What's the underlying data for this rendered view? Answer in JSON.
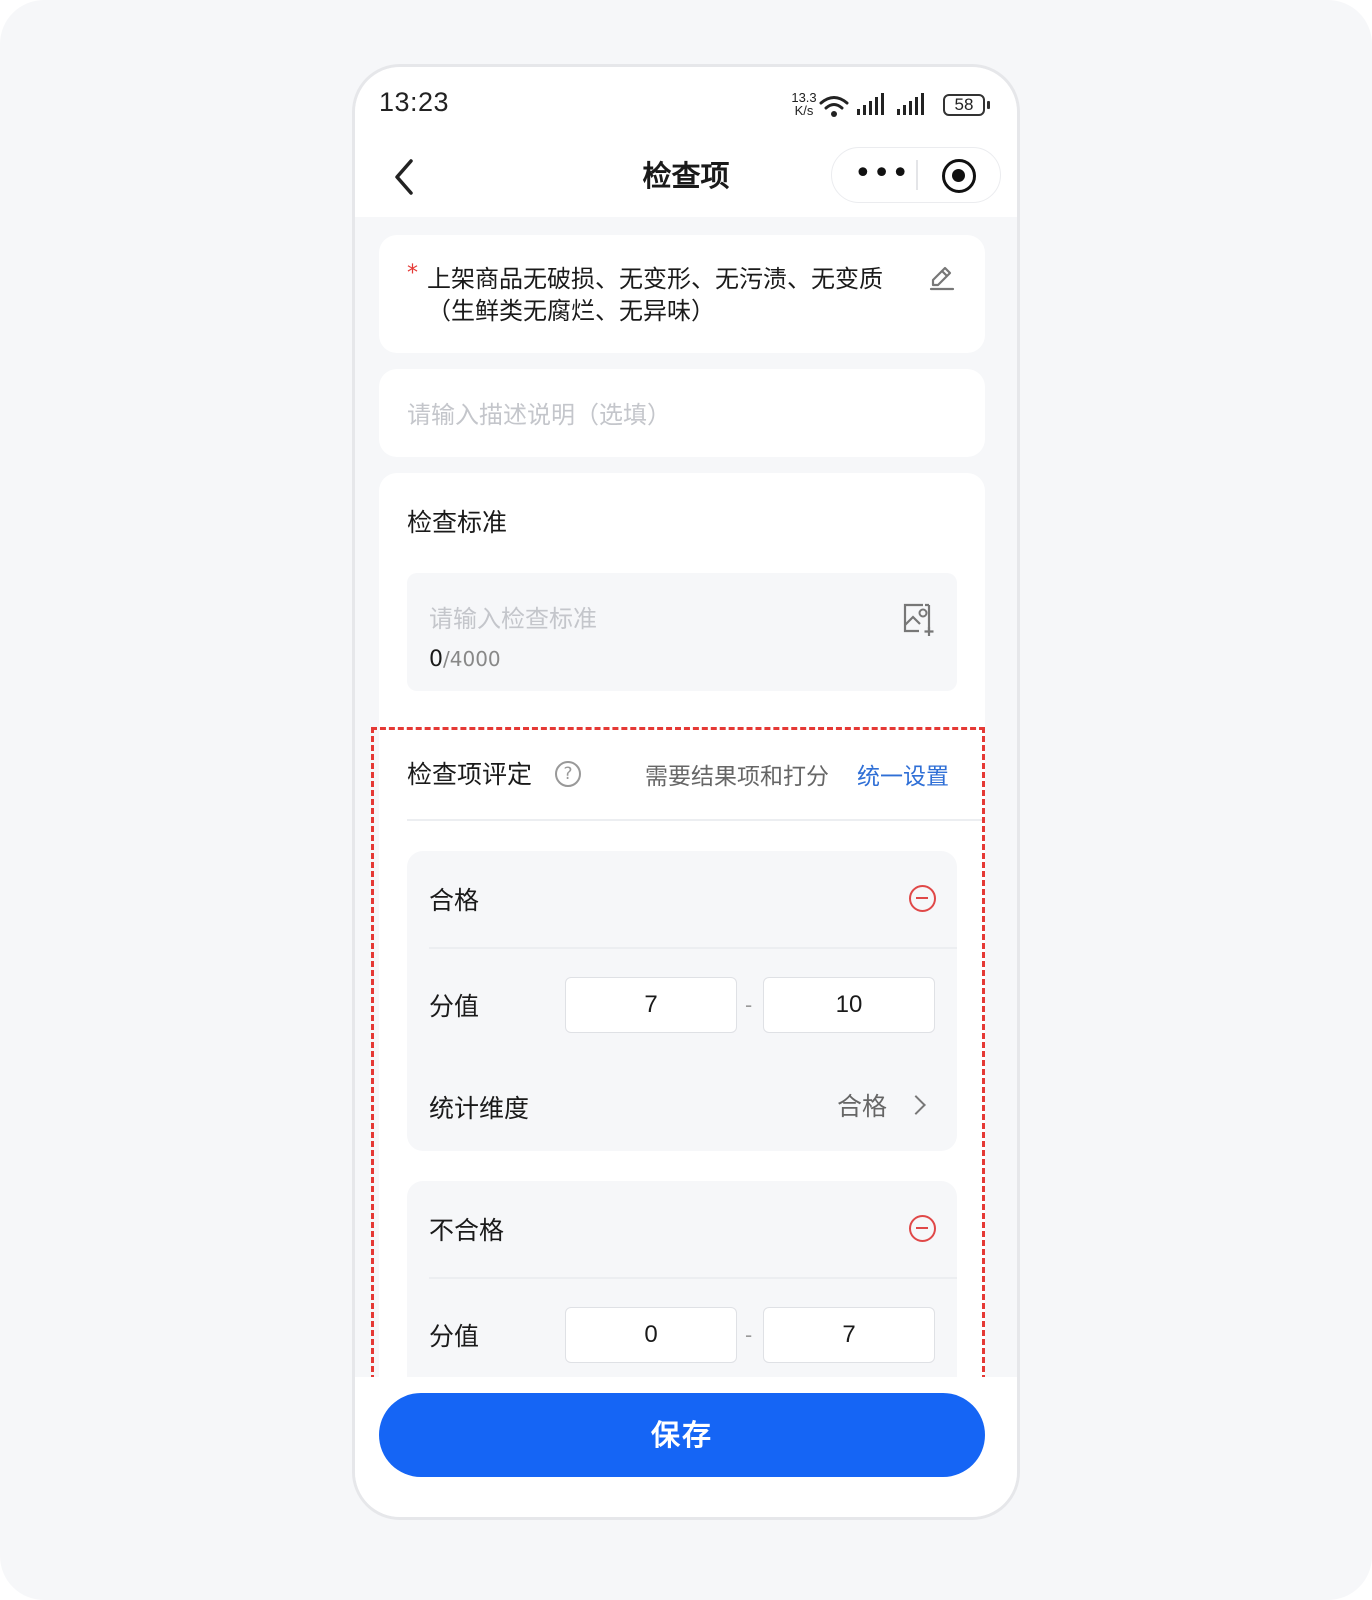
{
  "status_bar": {
    "time": "13:23",
    "net_speed_value": "13.3",
    "net_speed_unit": "K/s",
    "battery": "58"
  },
  "nav": {
    "title": "检查项",
    "more_label": "•••"
  },
  "item": {
    "required_mark": "*",
    "title": "上架商品无破损、无变形、无污渍、无变质（生鲜类无腐烂、无异味）"
  },
  "description": {
    "placeholder": "请输入描述说明（选填）"
  },
  "standard": {
    "label": "检查标准",
    "placeholder": "请输入检查标准",
    "count": "0",
    "max": "/4000"
  },
  "evaluation": {
    "label": "检查项评定",
    "help": "?",
    "hint": "需要结果项和打分",
    "link": "统一设置",
    "grades": [
      {
        "name": "合格",
        "score_label": "分值",
        "min": "7",
        "max": "10",
        "separator": "-",
        "dimension_label": "统计维度",
        "dimension_value": "合格"
      },
      {
        "name": "不合格",
        "score_label": "分值",
        "min": "0",
        "max": "7",
        "separator": "-"
      }
    ]
  },
  "footer": {
    "save_label": "保存"
  },
  "colors": {
    "primary": "#1565f5",
    "link": "#2f6fd6",
    "danger": "#e04848",
    "highlight": "#e53935",
    "background": "#f6f7f9"
  }
}
